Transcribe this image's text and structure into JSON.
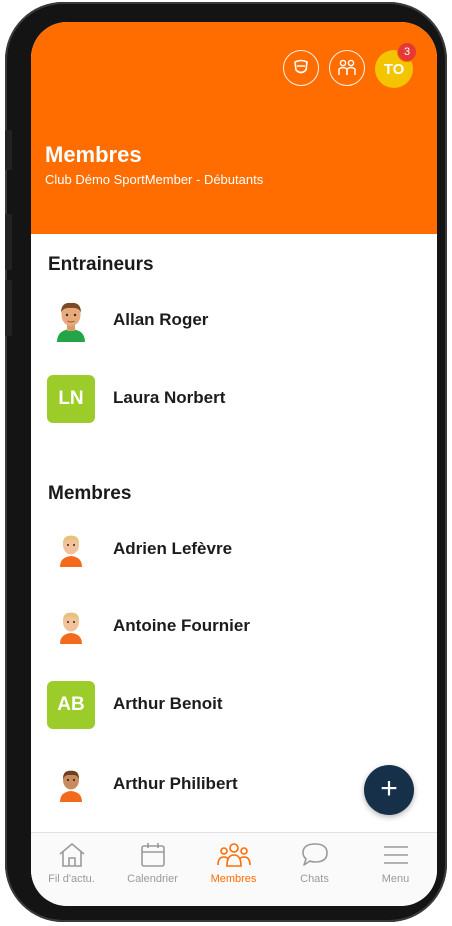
{
  "header": {
    "title": "Membres",
    "subtitle": "Club Démo SportMember - Débutants",
    "user_initials": "TO",
    "notification_count": "3",
    "accent_color": "#ff6d00"
  },
  "sections": {
    "trainers_title": "Entraineurs",
    "members_title": "Membres"
  },
  "trainers": [
    {
      "name": "Allan Roger",
      "avatar": "person-avatar-green"
    },
    {
      "name": "Laura Norbert",
      "initials": "LN"
    }
  ],
  "members": [
    {
      "name": "Adrien Lefèvre",
      "avatar": "person-avatar-orange"
    },
    {
      "name": "Antoine Fournier",
      "avatar": "person-avatar-orange"
    },
    {
      "name": "Arthur Benoit",
      "initials": "AB"
    },
    {
      "name": "Arthur Philibert",
      "avatar": "person-avatar-orange"
    }
  ],
  "fab": {
    "label": "+"
  },
  "tabbar": {
    "tabs": [
      {
        "label": "Fil d'actu.",
        "icon": "home-icon"
      },
      {
        "label": "Calendrier",
        "icon": "calendar-icon"
      },
      {
        "label": "Membres",
        "icon": "members-icon",
        "active": true
      },
      {
        "label": "Chats",
        "icon": "chat-icon"
      },
      {
        "label": "Menu",
        "icon": "menu-icon"
      }
    ]
  }
}
